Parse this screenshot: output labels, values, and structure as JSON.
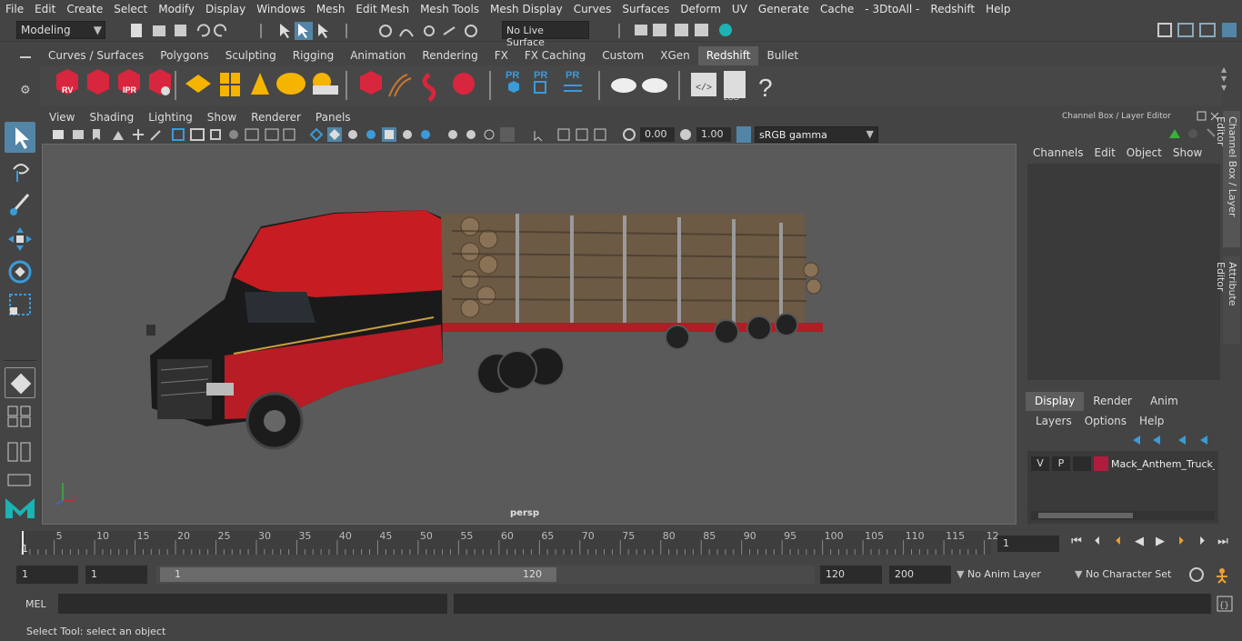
{
  "menubar": [
    "File",
    "Edit",
    "Create",
    "Select",
    "Modify",
    "Display",
    "Windows",
    "Mesh",
    "Edit Mesh",
    "Mesh Tools",
    "Mesh Display",
    "Curves",
    "Surfaces",
    "Deform",
    "UV",
    "Generate",
    "Cache",
    "- 3DtoAll -",
    "Redshift",
    "Help"
  ],
  "statusline": {
    "mode": "Modeling",
    "live_surface": "No Live Surface"
  },
  "shelf_tabs": [
    "Curves / Surfaces",
    "Polygons",
    "Sculpting",
    "Rigging",
    "Animation",
    "Rendering",
    "FX",
    "FX Caching",
    "Custom",
    "XGen",
    "Redshift",
    "Bullet"
  ],
  "shelf_active": "Redshift",
  "shelf_icons": {
    "rv": "RV",
    "ipr": "IPR",
    "pr1": "PR",
    "pr2": "PR",
    "pr3": "PR",
    "log": "LOG",
    "help": "?"
  },
  "viewport": {
    "menu": [
      "View",
      "Shading",
      "Lighting",
      "Show",
      "Renderer",
      "Panels"
    ],
    "exposure": "0.00",
    "gamma_value": "1.00",
    "color_space": "sRGB gamma",
    "camera": "persp"
  },
  "right_panel": {
    "title": "Channel Box / Layer Editor",
    "menu": [
      "Channels",
      "Edit",
      "Object",
      "Show"
    ],
    "tabs": [
      "Display",
      "Render",
      "Anim"
    ],
    "active_tab": "Display",
    "layer_menu": [
      "Layers",
      "Options",
      "Help"
    ],
    "layer": {
      "v": "V",
      "p": "P",
      "name": "Mack_Anthem_Truck_W",
      "color": "#b01c3c"
    },
    "side_tabs": [
      "Channel Box / Layer Editor",
      "Attribute Editor"
    ]
  },
  "timeline": {
    "ticks": [
      "5",
      "10",
      "15",
      "20",
      "25",
      "30",
      "35",
      "40",
      "45",
      "50",
      "55",
      "60",
      "65",
      "70",
      "75",
      "80",
      "85",
      "90",
      "95",
      "100",
      "105",
      "110",
      "115",
      "12"
    ],
    "start_tick": "1",
    "current_frame": "1"
  },
  "range": {
    "start": "1",
    "inner_start": "1",
    "slider_start": "1",
    "slider_end": "120",
    "end": "120",
    "max": "200",
    "anim_layer": "No Anim Layer",
    "char_set": "No Character Set"
  },
  "mel": {
    "label": "MEL"
  },
  "help_line": "Select Tool: select an object",
  "colors": {
    "accent": "#5285a6",
    "redshift": "#d7263d",
    "maya_logo": "#1bb3b3"
  }
}
